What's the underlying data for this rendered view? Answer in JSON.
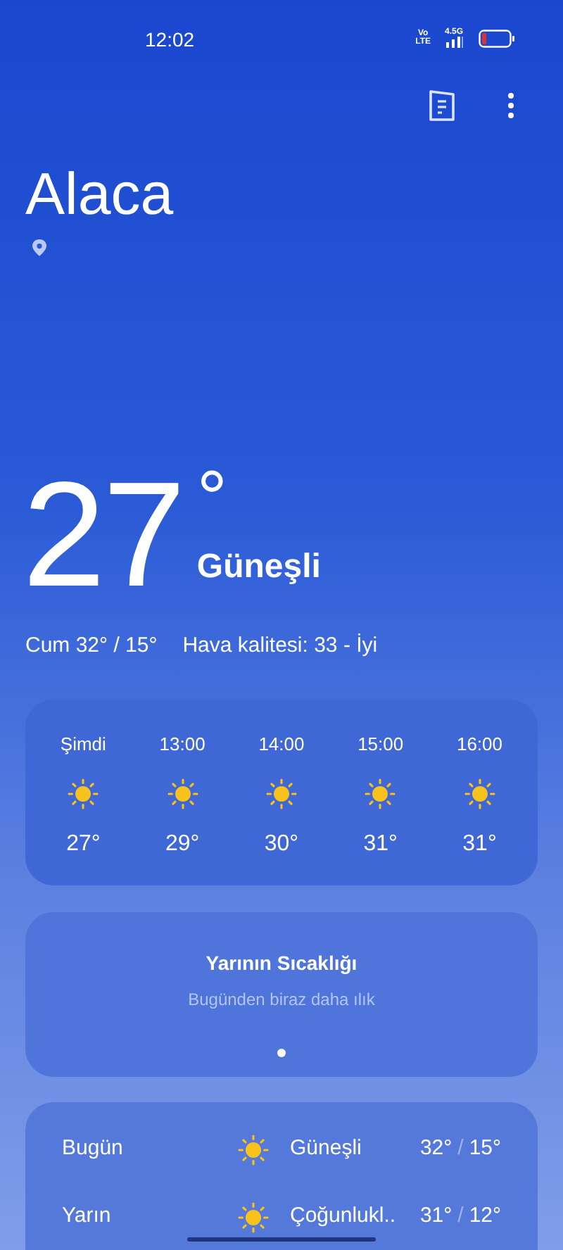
{
  "status_bar": {
    "time": "12:02",
    "volte_top": "Vo",
    "volte_bottom": "LTE",
    "network": "4.5G"
  },
  "location": {
    "city": "Alaca"
  },
  "current": {
    "temperature": "27",
    "degree": "°",
    "condition": "Güneşli",
    "day_range": "Cum 32° / 15°",
    "air_quality": "Hava kalitesi: 33 - İyi"
  },
  "hourly": [
    {
      "time": "Şimdi",
      "kind": "sun",
      "temp": "27°"
    },
    {
      "time": "13:00",
      "kind": "sun",
      "temp": "29°"
    },
    {
      "time": "14:00",
      "kind": "sun",
      "temp": "30°"
    },
    {
      "time": "15:00",
      "kind": "sun",
      "temp": "31°"
    },
    {
      "time": "16:00",
      "kind": "sun",
      "temp": "31°"
    }
  ],
  "tomorrow_card": {
    "title": "Yarının Sıcaklığı",
    "subtitle": "Bugünden biraz daha ılık",
    "page_dots": [
      {
        "selected": true
      }
    ]
  },
  "daily": [
    {
      "day": "Bugün",
      "kind": "sun",
      "condition": "Güneşli",
      "high": "32°",
      "separator": "/",
      "low": "15°"
    },
    {
      "day": "Yarın",
      "kind": "sun",
      "condition": "Çoğunlukl..",
      "high": "31°",
      "separator": "/",
      "low": "12°"
    }
  ]
}
